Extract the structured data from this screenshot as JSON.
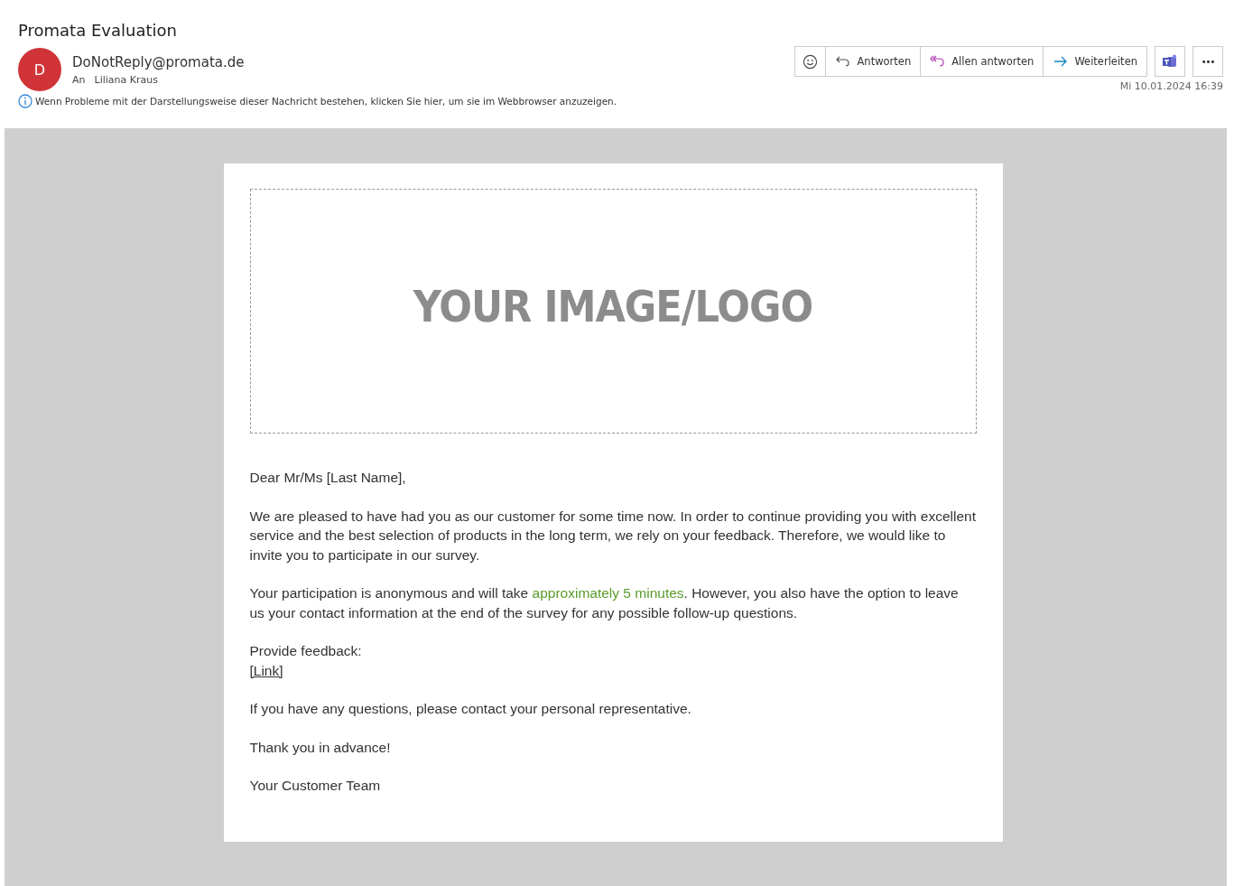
{
  "subject": "Promata Evaluation",
  "sender": {
    "initial": "D",
    "address": "DoNotReply@promata.de",
    "to_label": "An",
    "to": "Liliana Kraus"
  },
  "info": "Wenn Probleme mit der Darstellungsweise dieser Nachricht bestehen, klicken Sie hier, um sie im Webbrowser anzuzeigen.",
  "actions": [
    {
      "kind": "emoji"
    },
    {
      "kind": "reply",
      "label": "Antworten"
    },
    {
      "kind": "reply_all",
      "label": "Allen antworten"
    },
    {
      "kind": "forward",
      "label": "Weiterleiten"
    }
  ],
  "more": "•••",
  "date": "Mi 10.01.2024 16:39",
  "logo_placeholder": "YOUR IMAGE/LOGO",
  "body": [
    {
      "kind": "text",
      "segments": [
        {
          "kind": "plain",
          "text": "Dear Mr/Ms [Last Name],"
        }
      ]
    },
    {
      "kind": "text",
      "segments": [
        {
          "kind": "plain",
          "text": "We are pleased to have had you as our customer for some time now. In order to continue providing you with excellent service and the best selection of products in the long term, we rely on your feedback. Therefore, we would like to invite you to participate in our survey."
        }
      ]
    },
    {
      "kind": "text",
      "segments": [
        {
          "kind": "plain",
          "text": "Your participation is anonymous and will take "
        },
        {
          "kind": "highlight",
          "text": "approximately 5 minutes"
        },
        {
          "kind": "plain",
          "text": ". However, you also have the option to leave us your contact information at the end of the survey for any possible follow-up questions."
        }
      ]
    },
    {
      "kind": "link",
      "label": "Provide feedback:",
      "link": "[Link]"
    },
    {
      "kind": "text",
      "segments": [
        {
          "kind": "plain",
          "text": "If you have any questions, please contact your personal representative."
        }
      ]
    },
    {
      "kind": "text",
      "segments": [
        {
          "kind": "plain",
          "text": "Thank you in advance!"
        }
      ]
    },
    {
      "kind": "text",
      "segments": [
        {
          "kind": "plain",
          "text": "Your Customer Team"
        }
      ]
    }
  ]
}
